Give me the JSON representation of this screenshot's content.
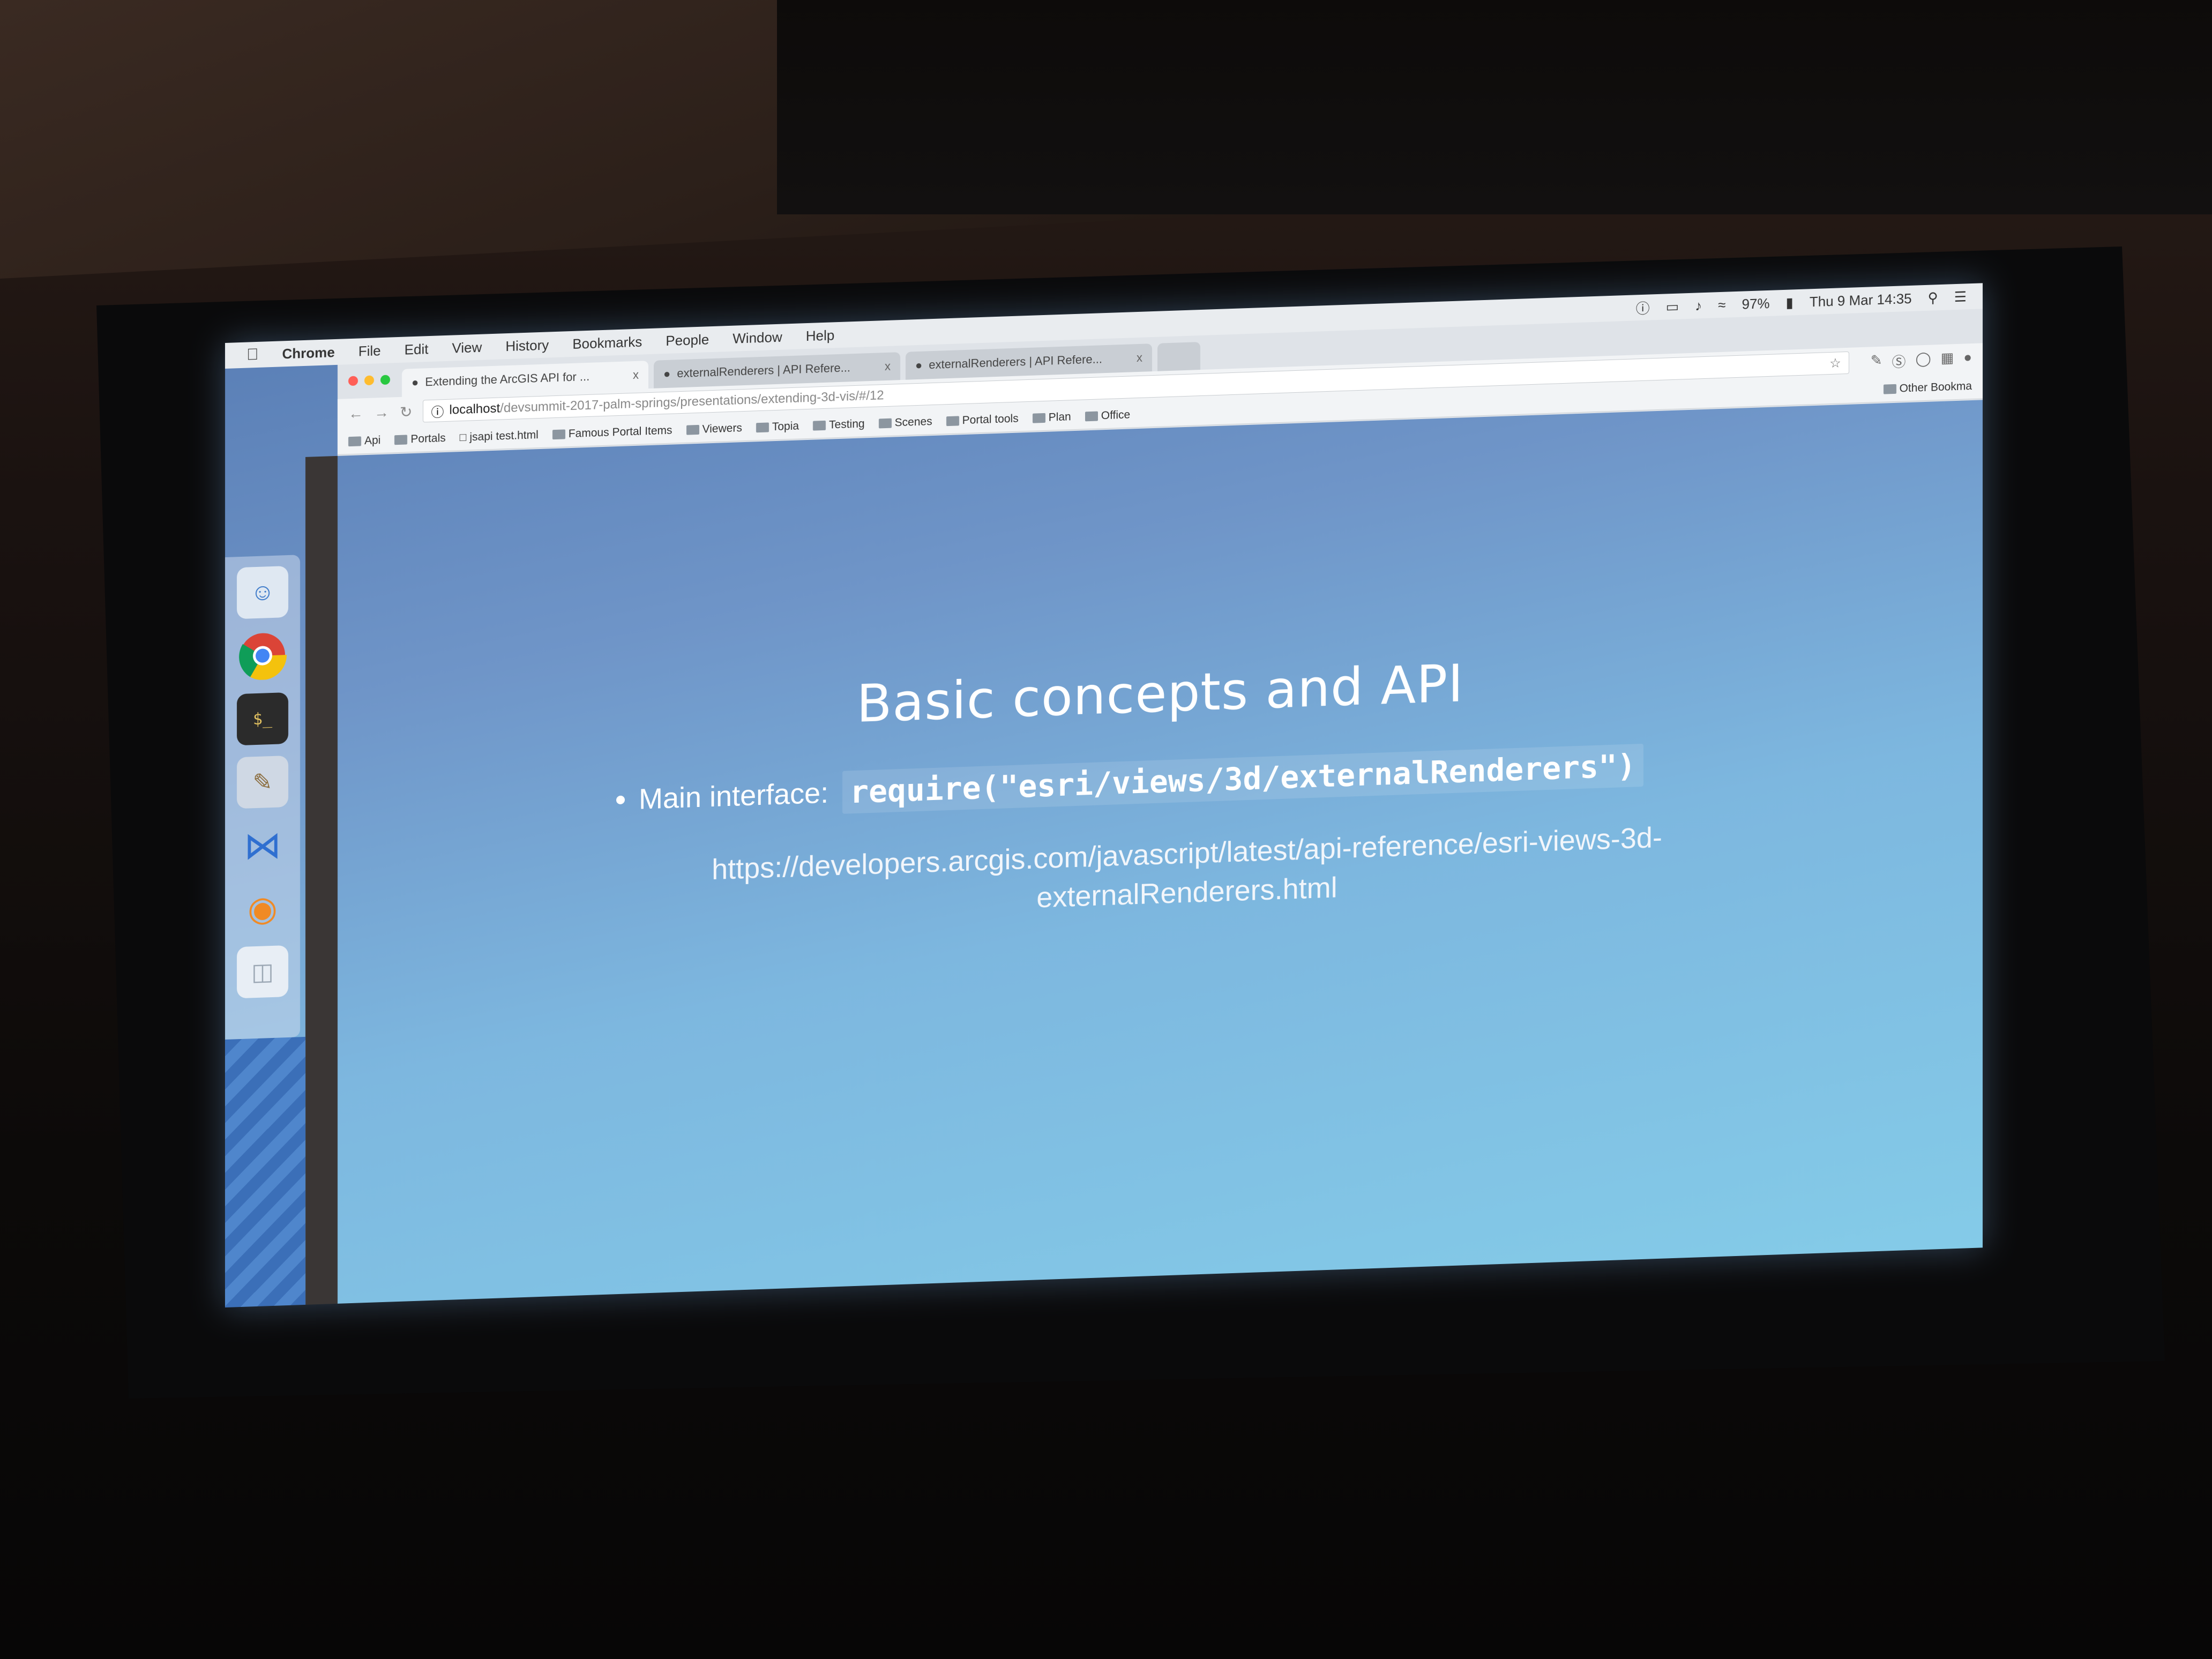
{
  "menubar": {
    "apple": "",
    "items": [
      "Chrome",
      "File",
      "Edit",
      "View",
      "History",
      "Bookmarks",
      "People",
      "Window",
      "Help"
    ],
    "battery": "97%",
    "clock": "Thu 9 Mar 14:35"
  },
  "browser": {
    "tabs": [
      {
        "title": "Extending the ArcGIS API for ..."
      },
      {
        "title": "externalRenderers | API Refere..."
      },
      {
        "title": "externalRenderers | API Refere..."
      }
    ],
    "tab_close": "x",
    "url_host": "localhost",
    "url_path": "/devsummit-2017-palm-springs/presentations/extending-3d-vis/#/12",
    "bookmarks": [
      "Api",
      "Portals",
      "jsapi test.html",
      "Famous Portal Items",
      "Viewers",
      "Topia",
      "Testing",
      "Scenes",
      "Portal tools",
      "Plan",
      "Office"
    ],
    "other_bookmarks": "Other Bookma"
  },
  "slide": {
    "title": "Basic concepts and API",
    "bullet_label": "Main interface:",
    "bullet_code": "require(\"esri/views/3d/externalRenderers\")",
    "link": "https://developers.arcgis.com/javascript/latest/api-reference/esri-views-3d-externalRenderers.html"
  },
  "colors": {
    "slide_top": "#5a7fb6",
    "slide_bottom": "#84cbe8",
    "menubar": "#e9ecef"
  }
}
